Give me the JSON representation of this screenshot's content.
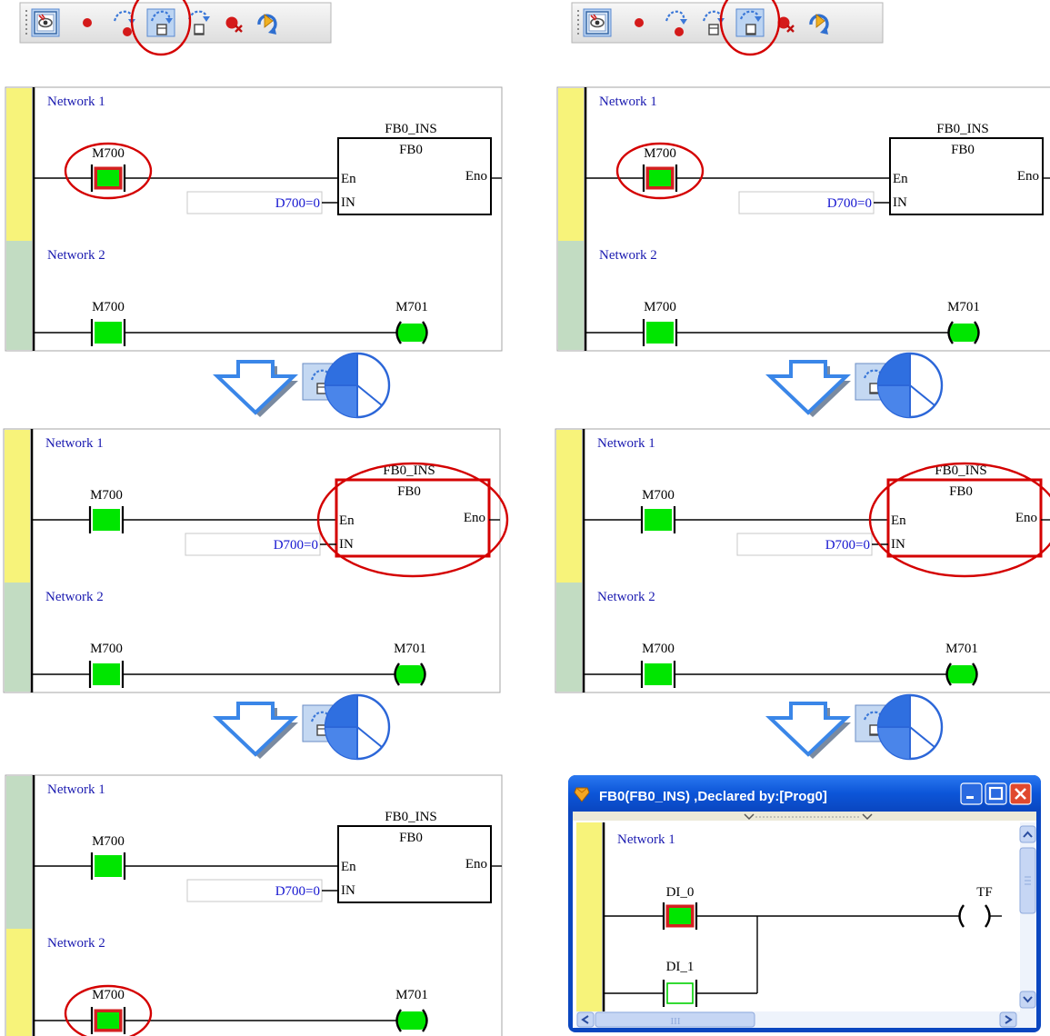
{
  "colors": {
    "bar_yellow": "#f7f37a",
    "bar_green": "#c2dcc2",
    "contact_on": "#00e600",
    "contact_border_active": "#d42020",
    "highlight_red": "#d40000",
    "arrow_blue": "#5a9ae6",
    "toolbar_bg": "#e9e9e9",
    "title_blue": "#0a50d8"
  },
  "toolbar_icons": [
    "monitor-icon",
    "breakpoint-icon",
    "step-over-icon",
    "step-into-icon",
    "step-out-icon",
    "clear-breakpoints-icon",
    "resume-icon"
  ],
  "panels": {
    "network1": "Network 1",
    "network2": "Network 2",
    "fb_instance": "FB0_INS",
    "fb_name": "FB0",
    "en": "En",
    "eno": "Eno",
    "in": "IN",
    "d_value": "D700=0",
    "contact": "M700",
    "coil": "M701"
  },
  "popup": {
    "title": "FB0(FB0_INS) ,Declared by:[Prog0]",
    "network": "Network 1",
    "contact1": "DI_0",
    "contact2": "DI_1",
    "coil": "TF",
    "hscroll": "III"
  }
}
